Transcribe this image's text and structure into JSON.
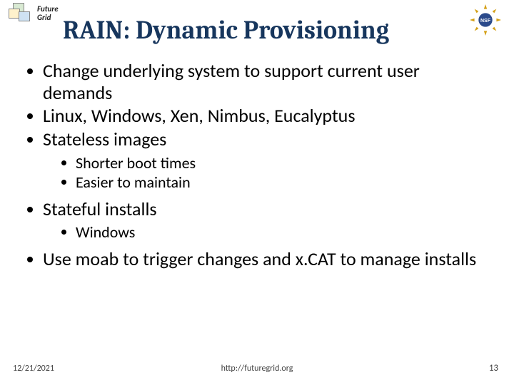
{
  "header": {
    "logo_line1": "Future",
    "logo_line2": "Grid"
  },
  "title": "RAIN: Dynamic Provisioning",
  "bullets": {
    "b1": "Change underlying system to support current user demands",
    "b2": "Linux, Windows, Xen, Nimbus, Eucalyptus",
    "b3": "Stateless images",
    "b3a": "Shorter boot times",
    "b3b": "Easier to maintain",
    "b4": "Stateful installs",
    "b4a": "Windows",
    "b5": "Use moab to trigger changes and x.CAT to manage installs"
  },
  "footer": {
    "date": "12/21/2021",
    "url": "http://futuregrid.org",
    "page": "13"
  }
}
